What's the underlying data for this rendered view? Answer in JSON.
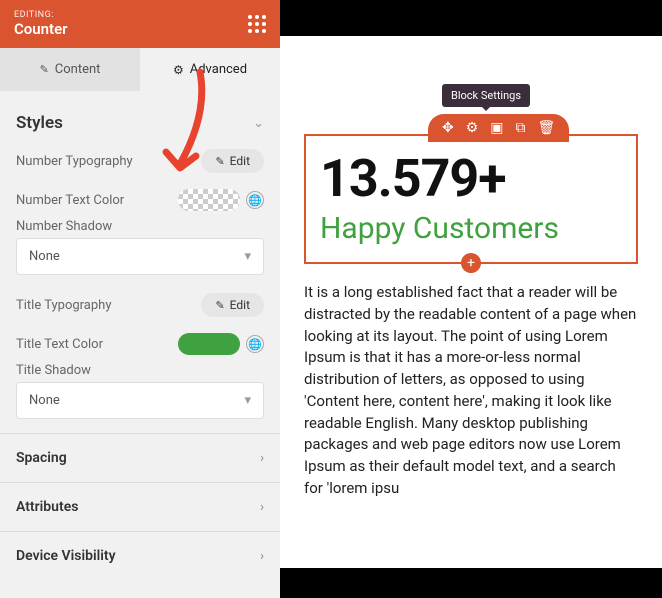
{
  "header": {
    "editing": "EDITING:",
    "title": "Counter"
  },
  "tabs": {
    "content": "Content",
    "advanced": "Advanced"
  },
  "styles": {
    "title": "Styles",
    "number_typography": "Number Typography",
    "number_text_color": "Number Text Color",
    "number_shadow": "Number Shadow",
    "number_shadow_value": "None",
    "title_typography": "Title Typography",
    "title_text_color": "Title Text Color",
    "title_shadow": "Title Shadow",
    "title_shadow_value": "None",
    "edit_label": "Edit"
  },
  "accordions": {
    "spacing": "Spacing",
    "attributes": "Attributes",
    "device": "Device Visibility"
  },
  "preview": {
    "tooltip": "Block Settings",
    "number": "13.579+",
    "subtitle": "Happy Customers",
    "paragraph": "It is a long established fact that a reader will be distracted by the readable content of a page when looking at its layout. The point of using Lorem Ipsum is that it has a more-or-less normal distribution of letters, as opposed to using 'Content here, content here', making it look like readable English. Many desktop publishing packages and web page editors now use Lorem Ipsum as their default model text, and a search for 'lorem ipsu"
  }
}
